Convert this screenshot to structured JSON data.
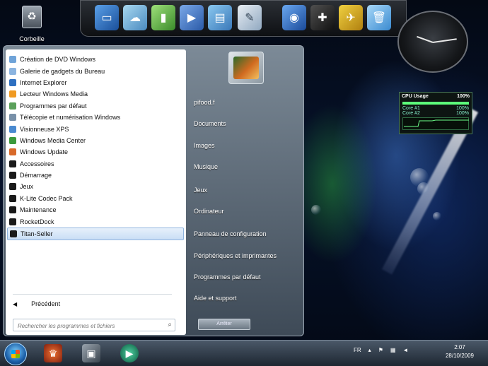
{
  "desktop": {
    "recycle_bin_label": "Corbeille"
  },
  "dock": {
    "icons": [
      "monitor-icon",
      "cloud-icon",
      "battery-icon",
      "media-icon",
      "folder-icon",
      "notepad-icon",
      "disk-icon",
      "gamepad-icon",
      "plane-icon",
      "trash-icon"
    ]
  },
  "cpu_gadget": {
    "title": "CPU Usage",
    "total": "100%",
    "core1_label": "Core #1",
    "core1_value": "100%",
    "core2_label": "Core #2",
    "core2_value": "100%"
  },
  "start_menu": {
    "programs": [
      {
        "label": "Création de DVD Windows",
        "color": "#6fa3d8"
      },
      {
        "label": "Galerie de gadgets du Bureau",
        "color": "#8bb4e0"
      },
      {
        "label": "Internet Explorer",
        "color": "#2d6fc0"
      },
      {
        "label": "Lecteur Windows Media",
        "color": "#f09a22"
      },
      {
        "label": "Programmes par défaut",
        "color": "#5aa05a"
      },
      {
        "label": "Télécopie et numérisation Windows",
        "color": "#7890a8"
      },
      {
        "label": "Visionneuse XPS",
        "color": "#4a8ad0"
      },
      {
        "label": "Windows Media Center",
        "color": "#3c9a3c"
      },
      {
        "label": "Windows Update",
        "color": "#d86a2a"
      },
      {
        "label": "Accessoires",
        "color": "#1a1a1a"
      },
      {
        "label": "Démarrage",
        "color": "#1a1a1a"
      },
      {
        "label": "Jeux",
        "color": "#1a1a1a"
      },
      {
        "label": "K-Lite Codec Pack",
        "color": "#1a1a1a"
      },
      {
        "label": "Maintenance",
        "color": "#1a1a1a"
      },
      {
        "label": "RocketDock",
        "color": "#1a1a1a"
      },
      {
        "label": "Titan-Seller",
        "color": "#1a1a1a"
      }
    ],
    "highlighted_index": 15,
    "back_label": "Précédent",
    "search_placeholder": "Rechercher les programmes et fichiers",
    "right_items": [
      "pifood.f",
      "Documents",
      "Images",
      "Musique",
      "Jeux",
      "Ordinateur",
      "Panneau de configuration",
      "Périphériques et imprimantes",
      "Programmes par défaut",
      "Aide et support"
    ],
    "shutdown_label": "Arrêter"
  },
  "taskbar": {
    "icons": [
      "game-icon",
      "camera-icon",
      "media-player-icon"
    ],
    "language": "FR",
    "time": "2:07",
    "date": "28/10/2009"
  }
}
